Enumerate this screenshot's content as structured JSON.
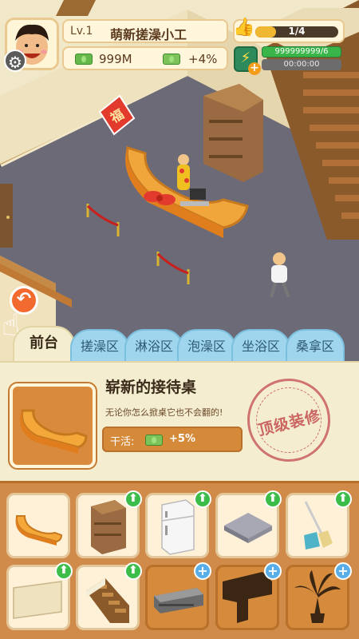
{
  "hud": {
    "level": "Lv.1",
    "title": "萌新搓澡小工",
    "progress_text": "1/4",
    "progress": 0.25,
    "money": "999M",
    "income_rate": "+4%",
    "energy": "999999999/6",
    "timer": "00:00:00"
  },
  "scene": {
    "fu_sign": "福"
  },
  "tabs": [
    {
      "label": "前台"
    },
    {
      "label": "搓澡区"
    },
    {
      "label": "淋浴区"
    },
    {
      "label": "泡澡区"
    },
    {
      "label": "坐浴区"
    },
    {
      "label": "桑拿区"
    }
  ],
  "item": {
    "name": "崭新的接待桌",
    "description": "无论你怎么掀桌它也不会翻的!",
    "work_label": "干活:",
    "work_value": "+5%",
    "stamp": "顶级装修"
  },
  "grid": {
    "items": [
      {
        "name": "reception-desk",
        "badge": "none"
      },
      {
        "name": "bookshelf",
        "badge": "upgrade"
      },
      {
        "name": "refrigerator",
        "badge": "upgrade"
      },
      {
        "name": "floor-mat",
        "badge": "upgrade"
      },
      {
        "name": "broom-dustpan",
        "badge": "upgrade"
      },
      {
        "name": "wall-panel",
        "badge": "upgrade"
      },
      {
        "name": "staircase",
        "badge": "upgrade"
      },
      {
        "name": "heater",
        "badge": "add"
      },
      {
        "name": "sofa-silhouette",
        "badge": "add"
      },
      {
        "name": "palm-plant-silhouette",
        "badge": "add"
      }
    ]
  },
  "colors": {
    "panel_bg": "#f4edcf",
    "tab_bg": "#9fd6ee",
    "grid_bg": "#d08a4a",
    "upgrade_badge": "#3cbd4a",
    "add_badge": "#5aaee8"
  }
}
